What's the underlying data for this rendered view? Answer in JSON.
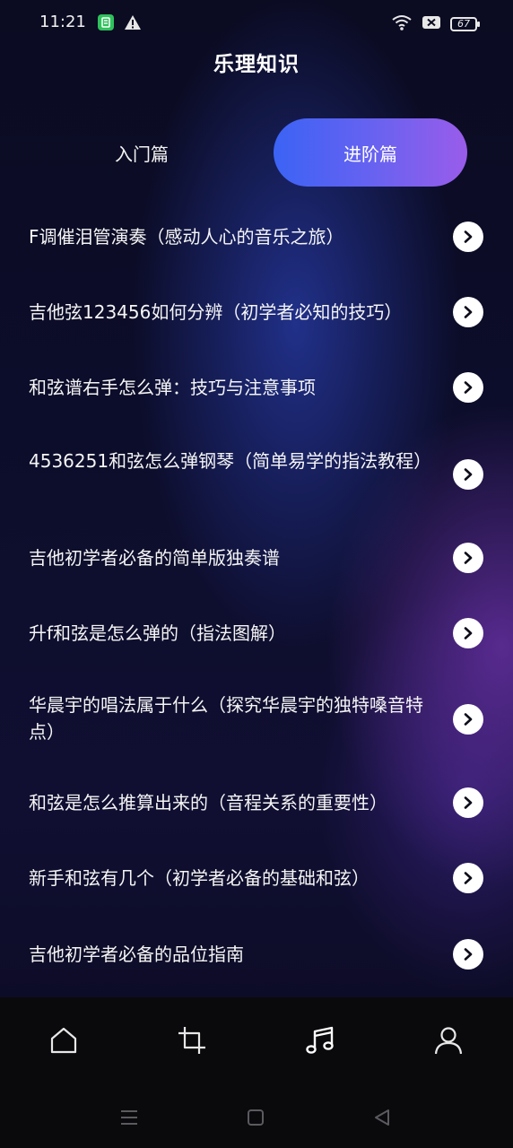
{
  "status_bar": {
    "time": "11:21",
    "battery": "67",
    "icons": [
      "app-notification-icon",
      "warning-icon",
      "wifi-icon",
      "sim-off-icon",
      "battery-icon"
    ]
  },
  "header": {
    "title": "乐理知识"
  },
  "tabs": [
    {
      "label": "入门篇",
      "active": false
    },
    {
      "label": "进阶篇",
      "active": true
    }
  ],
  "list": {
    "items": [
      {
        "title": "F调催泪管演奏（感动人心的音乐之旅）"
      },
      {
        "title": "吉他弦123456如何分辨（初学者必知的技巧）"
      },
      {
        "title": "和弦谱右手怎么弹：技巧与注意事项"
      },
      {
        "title": "4536251和弦怎么弹钢琴（简单易学的指法教程）"
      },
      {
        "title": "吉他初学者必备的简单版独奏谱"
      },
      {
        "title": "升f和弦是怎么弹的（指法图解）"
      },
      {
        "title": "华晨宇的唱法属于什么（探究华晨宇的独特嗓音特点）"
      },
      {
        "title": "和弦是怎么推算出来的（音程关系的重要性）"
      },
      {
        "title": "新手和弦有几个（初学者必备的基础和弦）"
      },
      {
        "title": "吉他初学者必备的品位指南"
      }
    ]
  },
  "bottom_nav": {
    "items": [
      {
        "icon": "home-icon",
        "active": false
      },
      {
        "icon": "crop-icon",
        "active": false
      },
      {
        "icon": "music-note-icon",
        "active": true
      },
      {
        "icon": "person-icon",
        "active": false
      }
    ]
  },
  "colors": {
    "accent_start": "#3b63f5",
    "accent_end": "#9a5cea",
    "background": "#0c0d2a"
  }
}
